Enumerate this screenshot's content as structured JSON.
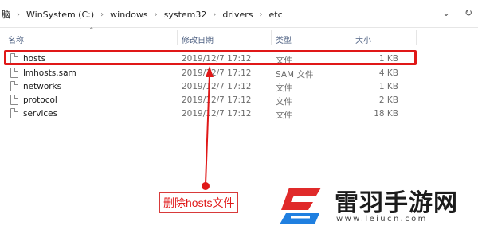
{
  "breadcrumb": {
    "items": [
      "脑",
      "WinSystem (C:)",
      "windows",
      "system32",
      "drivers",
      "etc"
    ],
    "separator": "›"
  },
  "address_actions": {
    "dropdown_glyph": "⌄",
    "refresh_glyph": "↻"
  },
  "columns": {
    "name": "名称",
    "date": "修改日期",
    "type": "类型",
    "size": "大小",
    "sort_glyph": "^"
  },
  "files": [
    {
      "name": "hosts",
      "date": "2019/12/7 17:12",
      "type": "文件",
      "size": "1 KB"
    },
    {
      "name": "lmhosts.sam",
      "date": "2019/12/7 17:12",
      "type": "SAM 文件",
      "size": "4 KB"
    },
    {
      "name": "networks",
      "date": "2019/12/7 17:12",
      "type": "文件",
      "size": "1 KB"
    },
    {
      "name": "protocol",
      "date": "2019/12/7 17:12",
      "type": "文件",
      "size": "2 KB"
    },
    {
      "name": "services",
      "date": "2019/12/7 17:12",
      "type": "文件",
      "size": "18 KB"
    }
  ],
  "annotation": {
    "label": "删除hosts文件"
  },
  "watermark": {
    "name": "雷羽手游网",
    "url": "www.leiucn.com"
  },
  "colors": {
    "highlight": "#e01818",
    "header_text": "#4d6082",
    "logo_red": "#e02a2a",
    "logo_blue": "#1f7fe0"
  },
  "icons": [
    "file-icon",
    "chevron-down-icon",
    "refresh-icon",
    "sort-up-icon",
    "arrow-icon",
    "logo-mark"
  ]
}
